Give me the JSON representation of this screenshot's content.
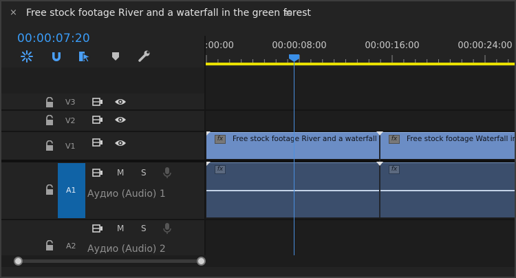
{
  "header": {
    "close_glyph": "×",
    "title": "Free stock footage River and a waterfall in the green forest",
    "menu_glyph": "≡"
  },
  "timecode": "00:00:07:20",
  "tools": [
    {
      "name": "snap-in-nested-icon"
    },
    {
      "name": "snap-magnet-icon"
    },
    {
      "name": "linked-selection-icon"
    },
    {
      "name": "add-marker-icon"
    },
    {
      "name": "settings-wrench-icon"
    }
  ],
  "ruler": {
    "labels": [
      ":00:00",
      "00:00:08:00",
      "00:00:16:00",
      "00:00:24:00"
    ]
  },
  "tracks": {
    "v3": {
      "label": "V3"
    },
    "v2": {
      "label": "V2"
    },
    "v1": {
      "label": "V1"
    },
    "a1": {
      "label": "A1",
      "name": "Аудио (Audio) 1",
      "mute": "M",
      "solo": "S"
    },
    "a2": {
      "label": "A2",
      "name": "Аудио (Audio) 2",
      "mute": "M",
      "solo": "S"
    }
  },
  "clips": {
    "video1": {
      "label": "Free stock footage River and a waterfall i",
      "fx": "fx"
    },
    "video2": {
      "label": "Free stock footage Waterfall in th",
      "fx": "fx"
    },
    "audio1": {
      "fx": "fx"
    },
    "audio2": {
      "fx": "fx"
    }
  },
  "colors": {
    "timecode": "#3a9bf5",
    "video_clip": "#6b8dc5",
    "audio_clip": "#3b4e6c",
    "work_area": "#e8e000",
    "target_active": "#1063a6"
  }
}
